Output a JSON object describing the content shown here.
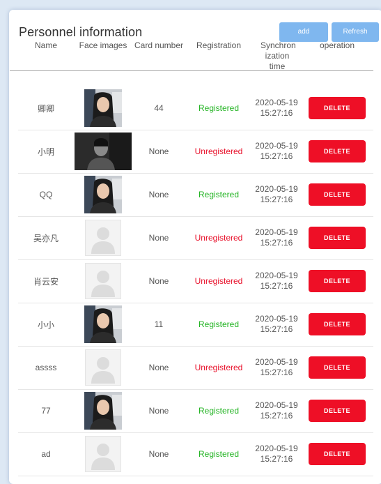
{
  "page": {
    "title": "Personnel information",
    "add_label": "add",
    "refresh_label": "Refresh"
  },
  "table": {
    "headers": {
      "name": "Name",
      "face": "Face images",
      "card": "Card number",
      "registration": "Registration",
      "sync": "Synchron ization time",
      "operation": "operation"
    },
    "delete_label": "DELETE",
    "rows": [
      {
        "name": "卿卿",
        "face": "photo",
        "card": "44",
        "registration": "Registered",
        "time_date": "2020-05-19",
        "time_clock": "15:27:16"
      },
      {
        "name": "小明",
        "face": "photo-dark",
        "card": "None",
        "registration": "Unregistered",
        "time_date": "2020-05-19",
        "time_clock": "15:27:16"
      },
      {
        "name": "QQ",
        "face": "photo",
        "card": "None",
        "registration": "Registered",
        "time_date": "2020-05-19",
        "time_clock": "15:27:16"
      },
      {
        "name": "吴亦凡",
        "face": "placeholder",
        "card": "None",
        "registration": "Unregistered",
        "time_date": "2020-05-19",
        "time_clock": "15:27:16"
      },
      {
        "name": "肖云安",
        "face": "placeholder",
        "card": "None",
        "registration": "Unregistered",
        "time_date": "2020-05-19",
        "time_clock": "15:27:16"
      },
      {
        "name": "小小",
        "face": "photo",
        "card": "11",
        "registration": "Registered",
        "time_date": "2020-05-19",
        "time_clock": "15:27:16"
      },
      {
        "name": "assss",
        "face": "placeholder",
        "card": "None",
        "registration": "Unregistered",
        "time_date": "2020-05-19",
        "time_clock": "15:27:16"
      },
      {
        "name": "77",
        "face": "photo",
        "card": "None",
        "registration": "Registered",
        "time_date": "2020-05-19",
        "time_clock": "15:27:16"
      },
      {
        "name": "ad",
        "face": "placeholder",
        "card": "None",
        "registration": "Registered",
        "time_date": "2020-05-19",
        "time_clock": "15:27:16"
      }
    ]
  },
  "colors": {
    "registered": "#22b322",
    "unregistered": "#e8102a",
    "delete_button": "#ee0f26",
    "top_buttons": "#7fb7ef"
  }
}
